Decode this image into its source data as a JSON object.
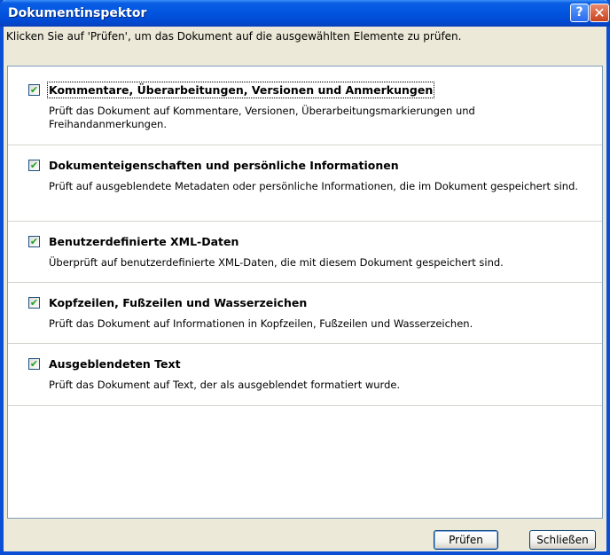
{
  "window": {
    "title": "Dokumentinspektor",
    "help_glyph": "?",
    "close_glyph": "✕"
  },
  "instruction": "Klicken Sie auf 'Prüfen', um das Dokument auf die ausgewählten Elemente zu prüfen.",
  "items": [
    {
      "checked": true,
      "title": "Kommentare, Überarbeitungen, Versionen und Anmerkungen",
      "description": "Prüft das Dokument auf Kommentare, Versionen, Überarbeitungsmarkierungen und Freihandanmerkungen."
    },
    {
      "checked": true,
      "title": "Dokumenteigenschaften und persönliche Informationen",
      "description": "Prüft auf ausgeblendete Metadaten oder persönliche Informationen, die im Dokument gespeichert sind."
    },
    {
      "checked": true,
      "title": "Benutzerdefinierte XML-Daten",
      "description": "Überprüft auf benutzerdefinierte XML-Daten, die mit diesem Dokument gespeichert sind."
    },
    {
      "checked": true,
      "title": "Kopfzeilen, Fußzeilen und Wasserzeichen",
      "description": "Prüft das Dokument auf Informationen in Kopfzeilen, Fußzeilen und Wasserzeichen."
    },
    {
      "checked": true,
      "title": "Ausgeblendeten Text",
      "description": "Prüft das Dokument auf Text, der als ausgeblendet formatiert wurde."
    }
  ],
  "buttons": {
    "check_label": "Prüfen",
    "close_label": "Schließen"
  },
  "colors": {
    "titlebar": "#0254e0",
    "check_mark": "#21a121",
    "dialog_bg": "#ece9d8"
  }
}
